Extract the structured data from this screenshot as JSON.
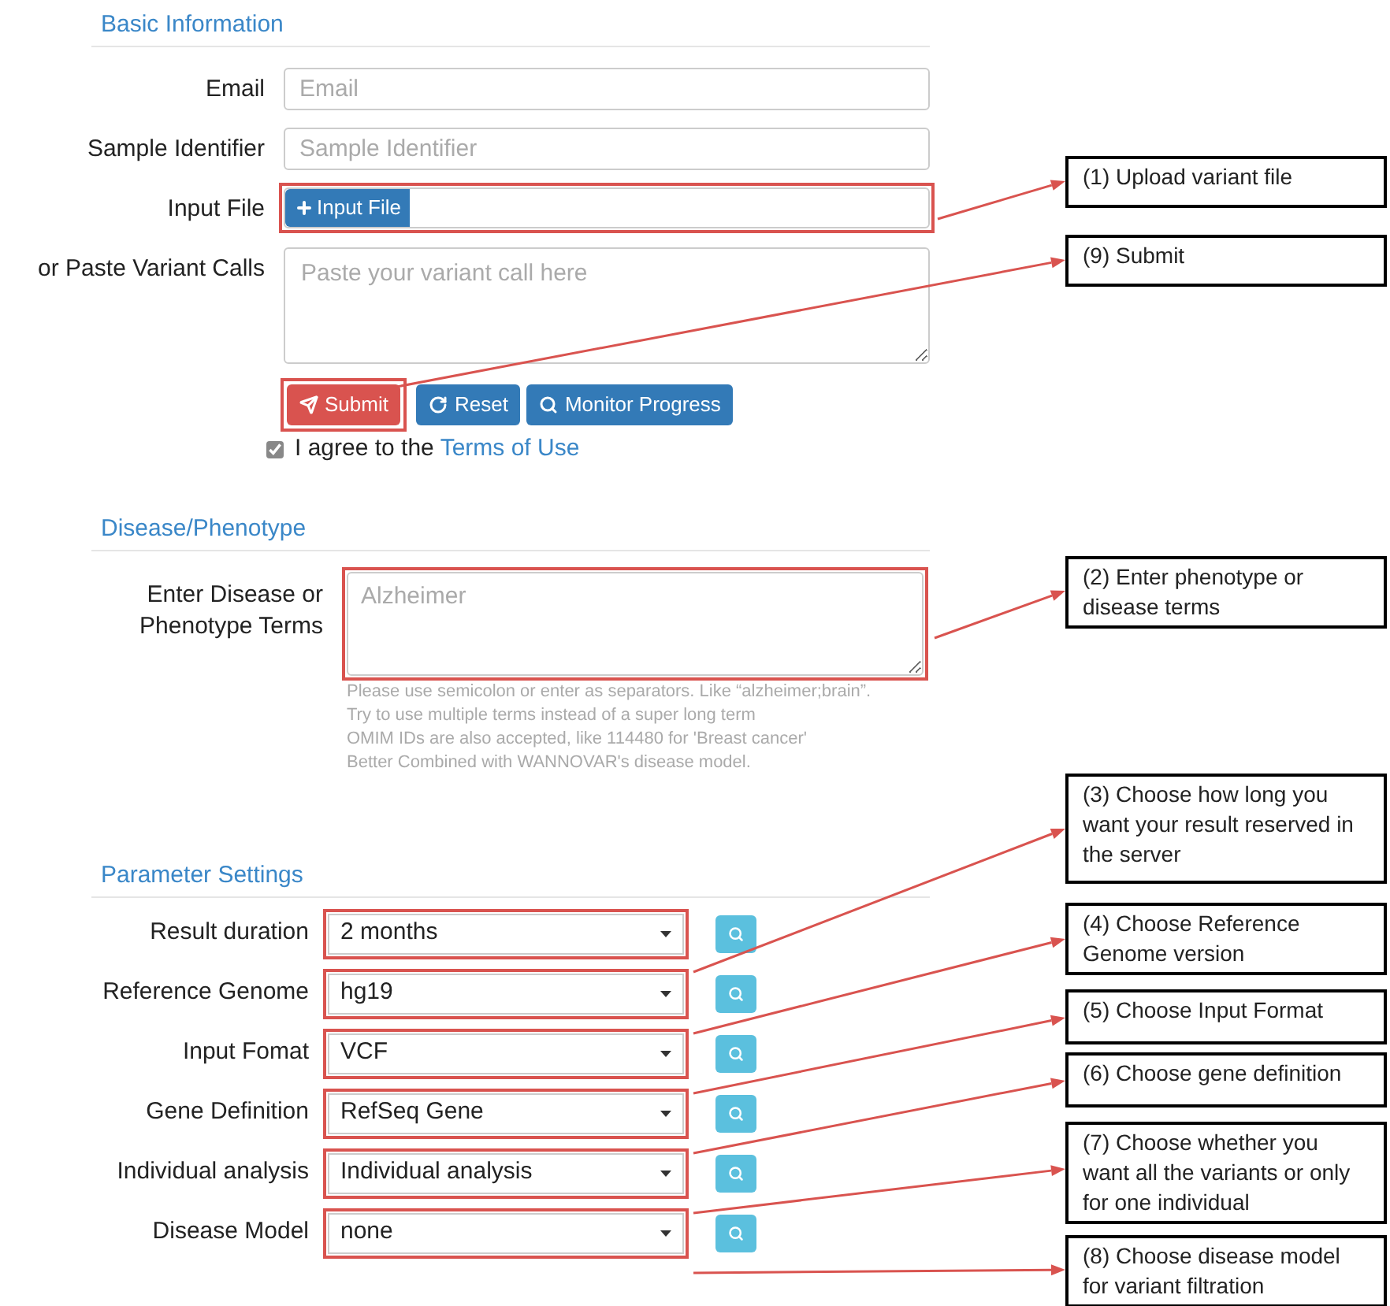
{
  "basic_information": {
    "heading": "Basic Information",
    "fields": [
      {
        "kind": "input",
        "label": "Email",
        "placeholder": "Email",
        "highlighted": false
      },
      {
        "kind": "input",
        "label": "Sample Identifier",
        "placeholder": "Sample Identifier",
        "highlighted": false
      },
      {
        "kind": "file",
        "label": "Input File",
        "button": "Input File",
        "highlighted": true
      },
      {
        "kind": "textarea",
        "label": "or Paste Variant Calls",
        "placeholder": "Paste your variant call here",
        "highlighted": false
      }
    ],
    "buttons": [
      {
        "kind": "submit",
        "label": "Submit",
        "highlighted": true
      },
      {
        "kind": "reset",
        "label": "Reset",
        "highlighted": false
      },
      {
        "kind": "monitor",
        "label": "Monitor Progress",
        "highlighted": false
      }
    ],
    "agree": {
      "checked": true,
      "text": "I agree to the",
      "link": "Terms of Use"
    }
  },
  "disease_phenotype": {
    "heading": "Disease/Phenotype",
    "label_lines": [
      "Enter Disease or",
      "Phenotype Terms"
    ],
    "placeholder": "Alzheimer",
    "highlighted": true,
    "help": [
      "Please use semicolon or enter as separators. Like “alzheimer;brain”.",
      "Try to use multiple terms instead of a super long term",
      "OMIM IDs are also accepted, like 114480 for 'Breast cancer'",
      "Better Combined with WANNOVAR's disease model."
    ]
  },
  "parameter_settings": {
    "heading": "Parameter Settings",
    "rows": [
      {
        "label": "Result duration",
        "value": "2 months",
        "highlighted": true
      },
      {
        "label": "Reference Genome",
        "value": "hg19",
        "highlighted": true
      },
      {
        "label": "Input Fomat",
        "value": "VCF",
        "highlighted": true
      },
      {
        "label": "Gene Definition",
        "value": "RefSeq Gene",
        "highlighted": true
      },
      {
        "label": "Individual analysis",
        "value": "Individual analysis",
        "highlighted": true
      },
      {
        "label": "Disease Model",
        "value": "none",
        "highlighted": true
      }
    ]
  },
  "callouts": [
    {
      "text": "(1) Upload variant  file"
    },
    {
      "text": "(9) Submit"
    },
    {
      "text": "(2) Enter phenotype or disease terms"
    },
    {
      "text": "(3) Choose how long you want your result reserved in the server"
    },
    {
      "text": "(4) Choose Reference Genome version"
    },
    {
      "text": "(5) Choose Input Format"
    },
    {
      "text": "(6) Choose gene definition"
    },
    {
      "text": "(7) Choose whether you want all the variants or only for one individual"
    },
    {
      "text": "(8) Choose disease model for variant filtration"
    }
  ]
}
